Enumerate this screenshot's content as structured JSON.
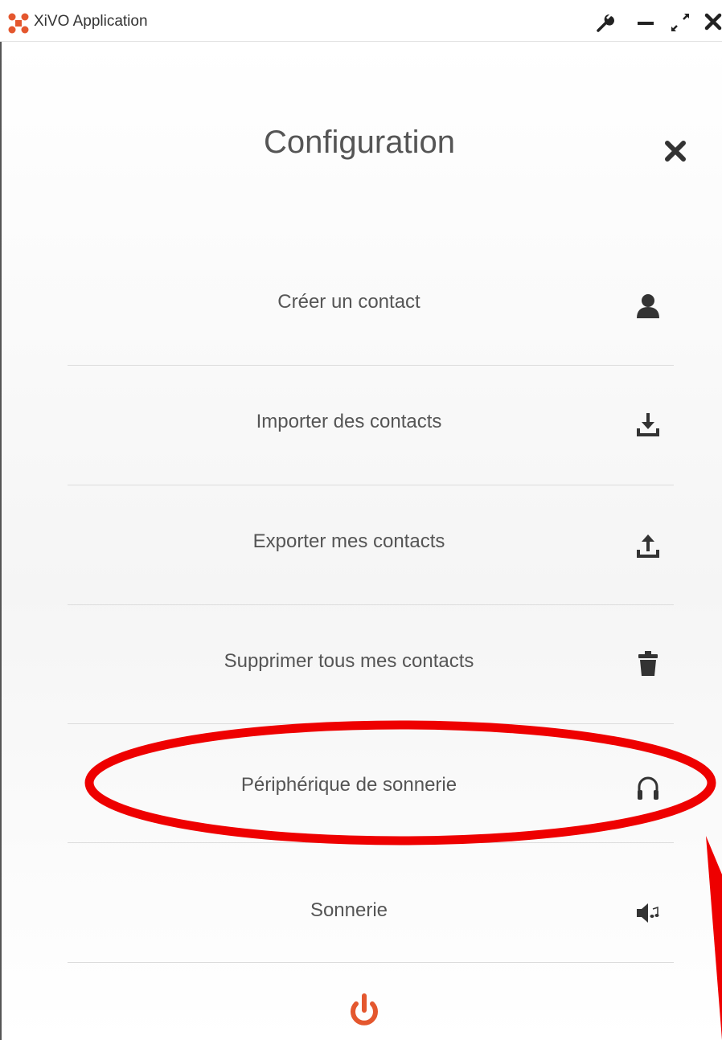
{
  "window": {
    "title": "XiVO Application",
    "controls": [
      "wrench-icon",
      "minimize-icon",
      "maximize-icon",
      "close-icon"
    ]
  },
  "panel": {
    "title": "Configuration",
    "close_icon": "close-icon"
  },
  "menu": {
    "items": [
      {
        "label": "Créer un contact",
        "icon": "user-icon"
      },
      {
        "label": "Importer des contacts",
        "icon": "download-icon"
      },
      {
        "label": "Exporter mes contacts",
        "icon": "upload-icon"
      },
      {
        "label": "Supprimer tous mes contacts",
        "icon": "trash-icon"
      },
      {
        "label": "Périphérique de sonnerie",
        "icon": "headphones-icon"
      },
      {
        "label": "Sonnerie",
        "icon": "volume-music-icon"
      }
    ]
  },
  "footer": {
    "power_icon": "power-icon"
  },
  "colors": {
    "accent": "#e4572e",
    "text": "#555555",
    "annotation": "#ee0000"
  }
}
